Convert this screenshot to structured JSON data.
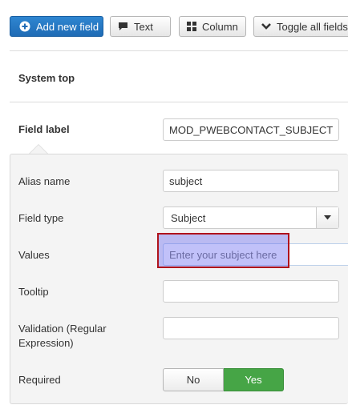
{
  "toolbar": {
    "add_label": "Add new field",
    "text_label": "Text",
    "column_label": "Column",
    "toggle_label": "Toggle all fields",
    "primary_color": "#2f86d1"
  },
  "section": {
    "system_top": "System top"
  },
  "field": {
    "label": "Field label",
    "label_value": "MOD_PWEBCONTACT_SUBJECT"
  },
  "form": {
    "alias_label": "Alias name",
    "alias_value": "subject",
    "type_label": "Field type",
    "type_value": "Subject",
    "values_label": "Values",
    "values_placeholder": "Enter your subject here",
    "tooltip_label": "Tooltip",
    "tooltip_value": "",
    "validation_label_line1": "Validation (Regular",
    "validation_label_line2": "Expression)",
    "validation_value": "",
    "required_label": "Required",
    "required_no": "No",
    "required_yes": "Yes",
    "required_selected": "Yes"
  },
  "icons": {
    "add": "plus-circle-icon",
    "text": "comment-icon",
    "column": "grid-icon",
    "toggle": "chevron-down-icon",
    "select": "caret-down-icon"
  },
  "colors": {
    "highlight_border": "#b0131c",
    "yes_active": "#46a546"
  }
}
